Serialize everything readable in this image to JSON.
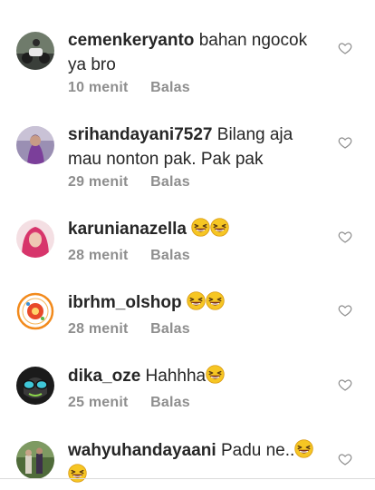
{
  "comments": [
    {
      "username": "cemenkeryanto",
      "text": "bahan ngocok ya bro",
      "emoji": "",
      "time": "10 menit",
      "reply_label": "Balas",
      "avatar": "photo-motorbike"
    },
    {
      "username": "srihandayani7527",
      "text": "Bilang aja mau nonton pak. Pak pak",
      "emoji": "",
      "time": "29 menit",
      "reply_label": "Balas",
      "avatar": "photo-purple-portrait"
    },
    {
      "username": "karunianazella",
      "text": "",
      "emoji": "😆😆",
      "time": "28 menit",
      "reply_label": "Balas",
      "avatar": "photo-pink-hijab"
    },
    {
      "username": "ibrhm_olshop",
      "text": "",
      "emoji": "😆😆",
      "time": "28 menit",
      "reply_label": "Balas",
      "avatar": "logo-orange-ring"
    },
    {
      "username": "dika_oze",
      "text": "Hahhha",
      "emoji": "😆",
      "time": "25 menit",
      "reply_label": "Balas",
      "avatar": "cartoon-sunglasses-face"
    },
    {
      "username": "wahyuhandayaani",
      "text": "Padu ne..",
      "emoji": "😆",
      "emoji2": "😆",
      "time": "",
      "reply_label": "",
      "avatar": "photo-group-outdoor"
    }
  ],
  "icons": {
    "like": "heart-outline-icon"
  },
  "colors": {
    "text": "#262626",
    "meta": "#8e8e8e",
    "heart": "#8e8e8e"
  }
}
